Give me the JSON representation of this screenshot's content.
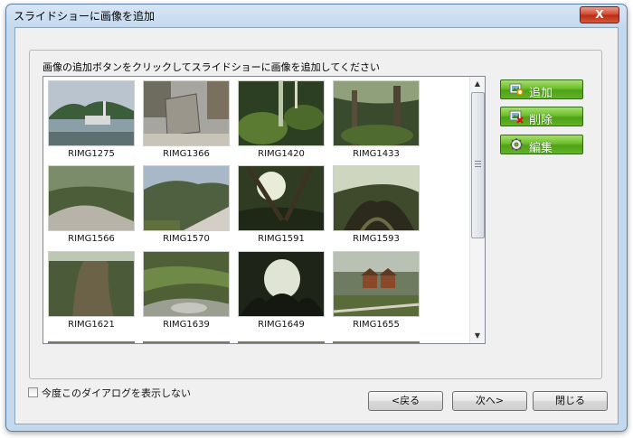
{
  "window": {
    "title": "スライドショーに画像を追加",
    "close_label": "X"
  },
  "main": {
    "instruction": "画像の追加ボタンをクリックしてスライドショーに画像を追加してください"
  },
  "images": [
    {
      "label": "RIMG1275",
      "scene": "coast"
    },
    {
      "label": "RIMG1366",
      "scene": "monument"
    },
    {
      "label": "RIMG1420",
      "scene": "moss"
    },
    {
      "label": "RIMG1433",
      "scene": "forest"
    },
    {
      "label": "RIMG1566",
      "scene": "rock"
    },
    {
      "label": "RIMG1570",
      "scene": "slope"
    },
    {
      "label": "RIMG1591",
      "scene": "canopy"
    },
    {
      "label": "RIMG1593",
      "scene": "roots"
    },
    {
      "label": "RIMG1621",
      "scene": "trunk"
    },
    {
      "label": "RIMG1639",
      "scene": "stream"
    },
    {
      "label": "RIMG1649",
      "scene": "hollow"
    },
    {
      "label": "RIMG1655",
      "scene": "hut"
    }
  ],
  "actions": {
    "add": "追加",
    "delete": "削除",
    "edit": "編集"
  },
  "footer": {
    "dont_show_label": "今度このダイアログを表示しない",
    "dont_show_checked": false,
    "back": "<戻る",
    "next": "次へ>",
    "close": "閉じる"
  }
}
